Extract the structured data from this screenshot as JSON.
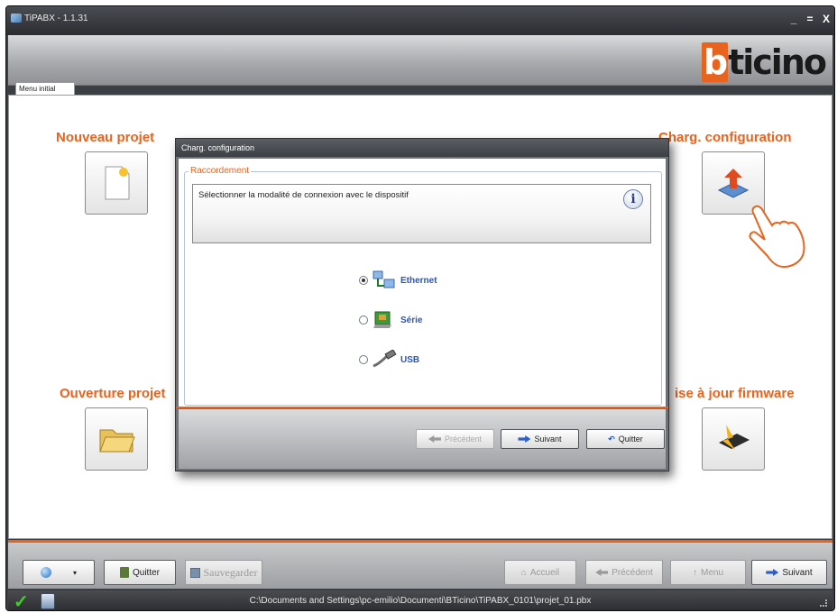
{
  "window": {
    "title": "TiPABX - 1.1.31",
    "minimize": "_",
    "maximize": "=",
    "close": "X"
  },
  "brand": {
    "logo_first": "b",
    "logo_rest": "ticino"
  },
  "tab": {
    "label": "Menu initial"
  },
  "actions": {
    "new_project": "Nouveau projet",
    "load_config": "Charg. configuration",
    "open_project": "Ouverture projet",
    "firmware": "ise à jour firmware"
  },
  "dialog": {
    "title": "Charg. configuration",
    "group_label": "Raccordement",
    "message": "Sélectionner la modalité de connexion avec le dispositif",
    "info_icon": "i",
    "options": [
      {
        "label": "Ethernet",
        "selected": true
      },
      {
        "label": "Série",
        "selected": false
      },
      {
        "label": "USB",
        "selected": false
      }
    ],
    "buttons": {
      "prev": "Précédent",
      "next": "Suivant",
      "quit": "Quitter"
    }
  },
  "toolbar": {
    "quit": "Quitter",
    "save": "Sauvegarder",
    "home": "Accueil",
    "prev": "Précédent",
    "menu": "Menu",
    "next": "Suivant"
  },
  "status": {
    "path": "C:\\Documents and Settings\\pc-emilio\\Documenti\\BTicino\\TiPABX_0101\\projet_01.pbx"
  },
  "colors": {
    "accent": "#e8641e",
    "link": "#2b55b5"
  }
}
